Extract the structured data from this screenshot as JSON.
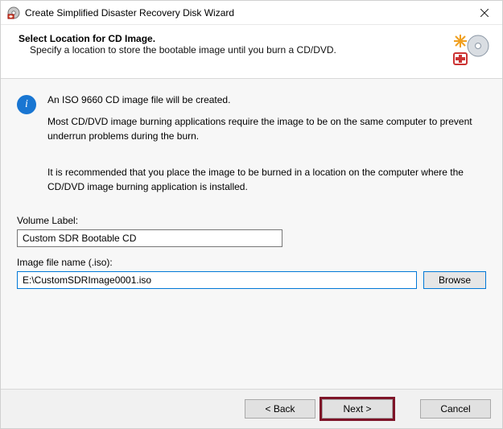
{
  "window": {
    "title": "Create Simplified Disaster Recovery Disk Wizard"
  },
  "header": {
    "heading": "Select Location for CD Image.",
    "subheading": "Specify a location to store the bootable image until you burn a CD/DVD."
  },
  "body": {
    "info_line1": "An ISO 9660 CD image file will be created.",
    "info_line2": "Most CD/DVD image burning applications require the image to be on the same computer to prevent underrun problems during the burn.",
    "recommendation": "It is recommended that you place the image to be burned in a location on the computer where the CD/DVD image burning application is installed.",
    "volume_label_caption": "Volume Label:",
    "volume_label_value": "Custom SDR Bootable CD",
    "image_name_caption": "Image file name (.iso):",
    "image_name_value": "E:\\CustomSDRImage0001.iso",
    "browse_label": "Browse"
  },
  "footer": {
    "back_label": "< Back",
    "next_label": "Next >",
    "cancel_label": "Cancel"
  },
  "icons": {
    "info_glyph": "i"
  }
}
